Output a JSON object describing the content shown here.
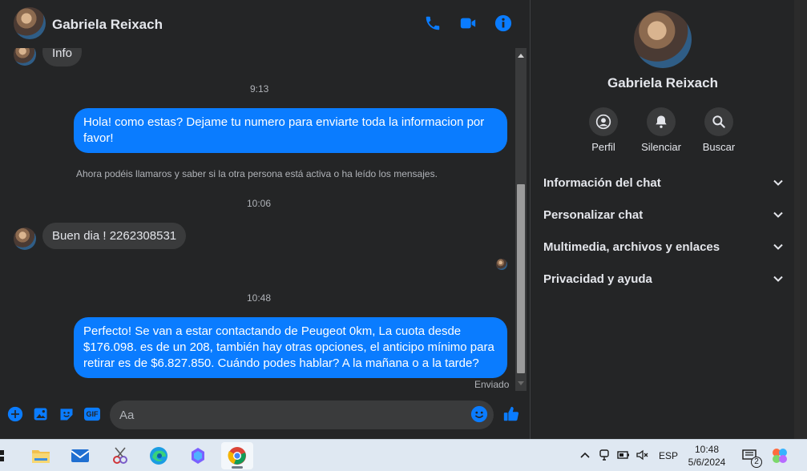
{
  "header": {
    "contact_name": "Gabriela Reixach",
    "icons": [
      "phone-icon",
      "video-camera-icon",
      "info-icon"
    ]
  },
  "messages": {
    "prev_message": "Info",
    "time_1": "9:13",
    "outgoing_1": "Hola! como estas? Dejame tu numero para enviarte toda la informacion por favor!",
    "system_note": "Ahora podéis llamaros y saber si la otra persona está activa o ha leído los mensajes.",
    "time_2": "10:06",
    "incoming_1": "Buen dia ! 2262308531",
    "time_3": "10:48",
    "outgoing_2": "Perfecto!  Se van a estar contactando de Peugeot 0km, La cuota desde $176.098. es de un 208, también hay otras opciones, el anticipo mínimo para retirar es de $6.827.850. Cuándo podes hablar? A la mañana o a la tarde?",
    "status": "Enviado"
  },
  "composer": {
    "placeholder": "Aa",
    "icons": [
      "plus-icon",
      "image-icon",
      "sticker-icon",
      "gif-icon",
      "emoji-icon",
      "like-icon"
    ],
    "gif_label": "GIF"
  },
  "info_panel": {
    "name": "Gabriela Reixach",
    "actions": [
      {
        "label": "Perfil",
        "icon": "profile-icon"
      },
      {
        "label": "Silenciar",
        "icon": "bell-icon"
      },
      {
        "label": "Buscar",
        "icon": "search-icon"
      }
    ],
    "sections": [
      {
        "label": "Información del chat"
      },
      {
        "label": "Personalizar chat"
      },
      {
        "label": "Multimedia, archivos y enlaces"
      },
      {
        "label": "Privacidad y ayuda"
      }
    ]
  },
  "taskbar": {
    "apps": [
      "file-explorer-icon",
      "mail-icon",
      "snipping-tool-icon",
      "edge-icon",
      "copilot-icon",
      "chrome-icon"
    ],
    "language": "ESP",
    "time": "10:48",
    "date": "5/6/2024",
    "notification_count": "2"
  },
  "colors": {
    "background": "#242526",
    "bubble_outgoing": "#0a7cff",
    "bubble_incoming": "#3a3b3c",
    "accent": "#0a7cff"
  }
}
